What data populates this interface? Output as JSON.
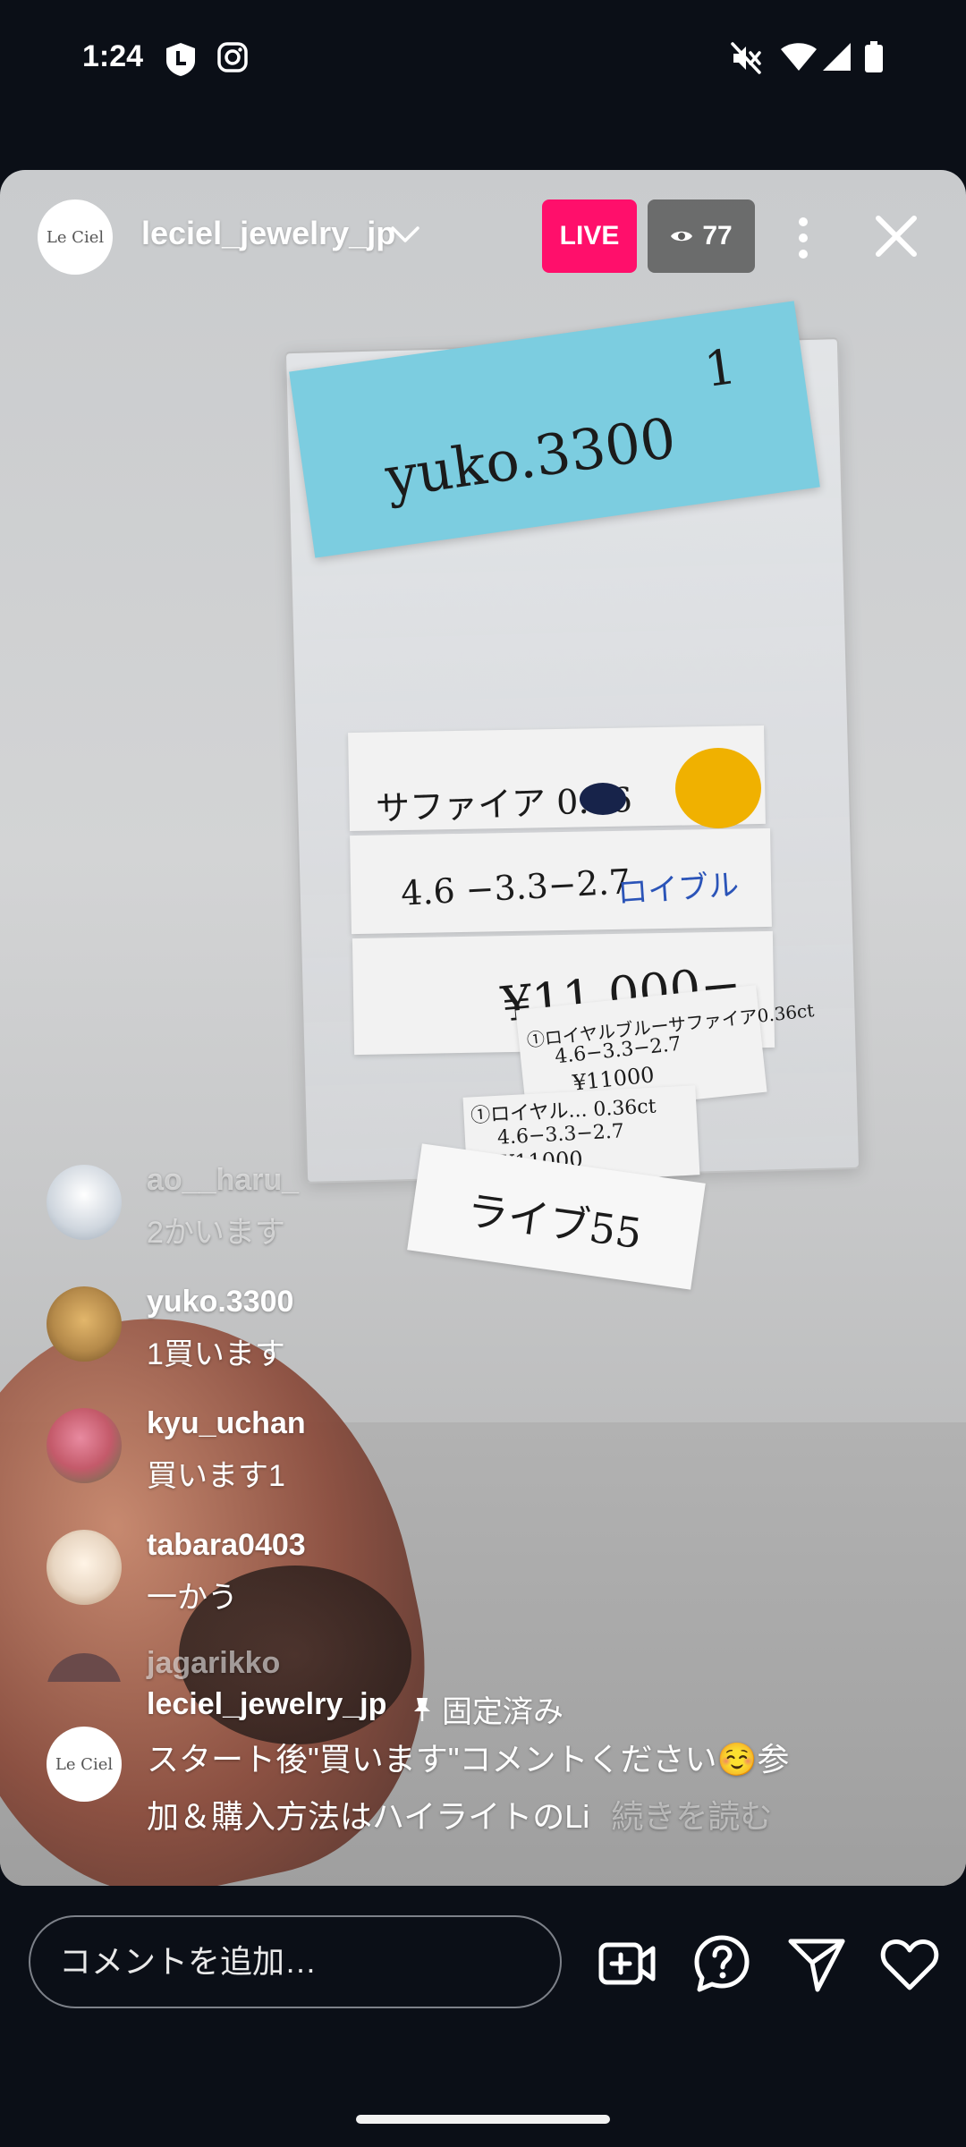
{
  "status_bar": {
    "time": "1:24",
    "icons": [
      "l-app-icon",
      "instagram-icon",
      "mute-icon",
      "wifi-icon",
      "signal-icon",
      "battery-icon"
    ]
  },
  "live": {
    "host_avatar_text": "Le Ciel",
    "host_name": "leciel_jewelry_jp",
    "live_label": "LIVE",
    "viewer_count": "77"
  },
  "video": {
    "note_name": "yuko.3300",
    "note_number": "1",
    "label1": "サファイア 0.36",
    "label2": "4.6 −3.3−2.7",
    "label2b": "ロイブル",
    "label3": "¥11,000−",
    "small1_line1": "①ロイヤルブルーサファイア0.36ct",
    "small1_line2": "4.6−3.3−2.7",
    "small1_line3": "¥11000",
    "small2_line1": "①ロイヤル... 0.36ct",
    "small2_line2": "4.6−3.3−2.7",
    "small2_line3": "¥11000",
    "tag": "ライブ55"
  },
  "comments": [
    {
      "user": "ao__haru_",
      "text": "2かいます",
      "faded": true,
      "avatar_color": "#d9dde2"
    },
    {
      "user": "yuko.3300",
      "text": "1買います",
      "faded": false,
      "avatar_color": "#b58a4a"
    },
    {
      "user": "kyu_uchan",
      "text": "買います1",
      "faded": false,
      "avatar_color": "#c45a6a"
    },
    {
      "user": "tabara0403",
      "text": "一かう",
      "faded": false,
      "avatar_color": "#e8d6c2"
    },
    {
      "user": "jagarikko",
      "text": "",
      "faded": true,
      "avatar_color": "#6a4a4a"
    }
  ],
  "pinned": {
    "user": "leciel_jewelry_jp",
    "pinned_label": "固定済み",
    "line1": "スタート後\"買います\"コメントください☺️参",
    "line2": "加＆購入方法はハイライトのLi",
    "more": "続きを読む",
    "avatar_text": "Le Ciel"
  },
  "bottom_bar": {
    "comment_placeholder": "コメントを追加…"
  },
  "colors": {
    "live_badge": "#ff0f6b",
    "background": "#0b0f17"
  }
}
